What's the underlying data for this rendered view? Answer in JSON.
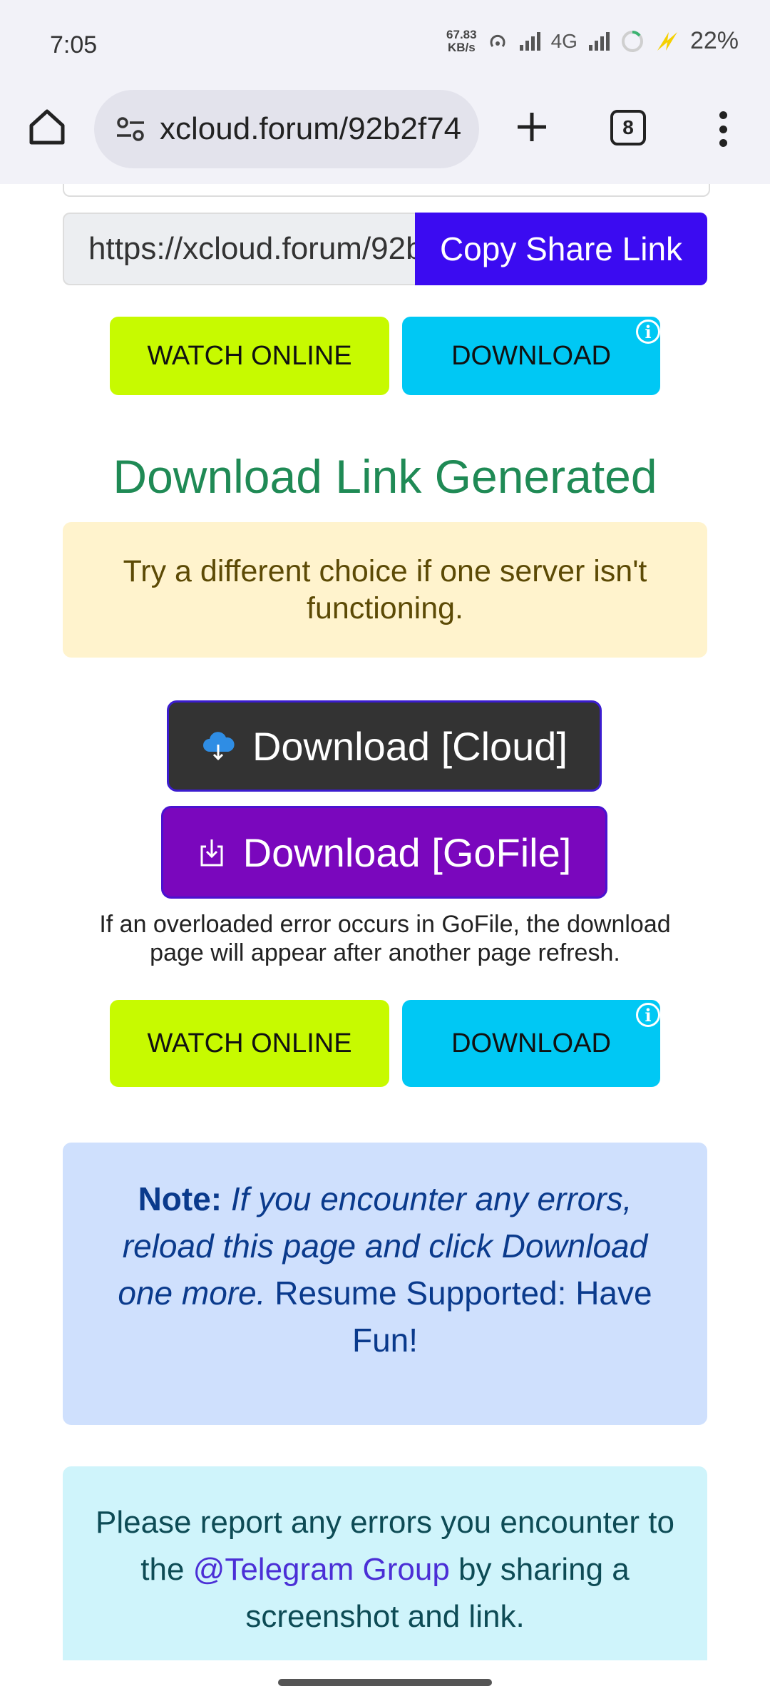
{
  "status_bar": {
    "time": "7:05",
    "speed_value": "67.83",
    "speed_unit": "KB/s",
    "network": "4G",
    "battery": "22%"
  },
  "browser": {
    "url": "xcloud.forum/92b2f74",
    "tab_count": "8"
  },
  "share": {
    "link_value": "https://xcloud.forum/92b2f74",
    "copy_label": "Copy Share Link"
  },
  "buttons_top": {
    "watch_label": "WATCH ONLINE",
    "download_label": "DOWNLOAD",
    "info_glyph": "i"
  },
  "generated": {
    "title": "Download Link Generated",
    "warning": "Try a different choice if one server isn't functioning."
  },
  "servers": {
    "cloud_label": "Download [Cloud]",
    "gofile_label": "Download [GoFile]",
    "gofile_note": "If an overloaded error occurs in GoFile, the download page will appear after another page refresh."
  },
  "buttons_bottom": {
    "watch_label": "WATCH ONLINE",
    "download_label": "DOWNLOAD",
    "info_glyph": "i"
  },
  "note": {
    "label": "Note:",
    "italic_text": "If you encounter any errors, reload this page and click Download one more.",
    "plain_text": "Resume Supported: Have Fun!"
  },
  "report": {
    "text_before": "Please report any errors you encounter to the",
    "link_text": "@Telegram Group",
    "text_after": "by sharing a screenshot and link."
  },
  "colors": {
    "copy_button": "#3b0bf1",
    "watch_button": "#c7fa00",
    "download_button": "#00c8f4",
    "title_green": "#1f8a55",
    "cloud_button": "#333333",
    "gofile_button": "#7a07bd"
  }
}
